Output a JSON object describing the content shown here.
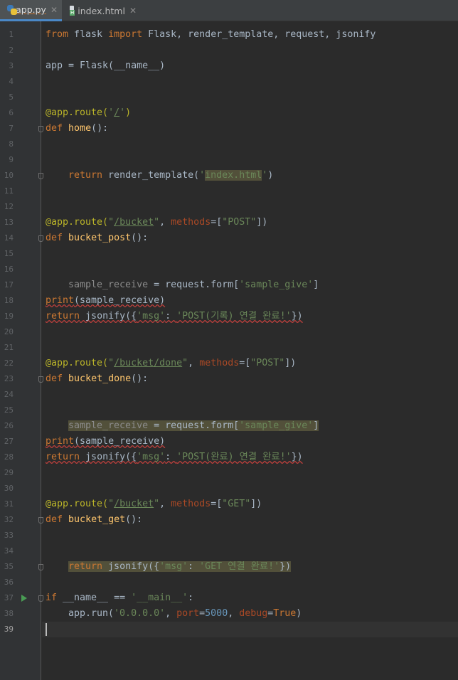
{
  "tabs": [
    {
      "label": "app.py",
      "active": true,
      "icon": "python-file-icon"
    },
    {
      "label": "index.html",
      "active": false,
      "icon": "html-file-icon"
    }
  ],
  "editor": {
    "current_line": 39,
    "run_gutter_line": 37,
    "lines": [
      {
        "n": 1,
        "indent": 0,
        "fold": false,
        "warn": false,
        "hl": false,
        "tokens": [
          [
            "from",
            "kw"
          ],
          [
            " flask ",
            ""
          ],
          [
            "import",
            "kw"
          ],
          [
            " Flask, render_template, request, jsonify",
            ""
          ]
        ]
      },
      {
        "n": 2,
        "indent": 0,
        "fold": false,
        "warn": false,
        "hl": false,
        "tokens": []
      },
      {
        "n": 3,
        "indent": 0,
        "fold": false,
        "warn": false,
        "hl": false,
        "tokens": [
          [
            "app = Flask(__name__)",
            ""
          ]
        ]
      },
      {
        "n": 4,
        "indent": 0,
        "fold": false,
        "warn": false,
        "hl": false,
        "tokens": []
      },
      {
        "n": 5,
        "indent": 0,
        "fold": false,
        "warn": false,
        "hl": false,
        "tokens": []
      },
      {
        "n": 6,
        "indent": 0,
        "fold": false,
        "warn": false,
        "hl": false,
        "tokens": [
          [
            "@app.route(",
            "dec"
          ],
          [
            "'",
            "str"
          ],
          [
            "/",
            "str ul"
          ],
          [
            "'",
            "str"
          ],
          [
            ")",
            "dec"
          ]
        ]
      },
      {
        "n": 7,
        "indent": 0,
        "fold": true,
        "warn": false,
        "hl": false,
        "tokens": [
          [
            "def",
            "kw"
          ],
          [
            " ",
            ""
          ],
          [
            "home",
            "fn"
          ],
          [
            "():",
            ""
          ]
        ]
      },
      {
        "n": 8,
        "indent": 0,
        "fold": false,
        "warn": false,
        "hl": false,
        "tokens": []
      },
      {
        "n": 9,
        "indent": 0,
        "fold": false,
        "warn": false,
        "hl": false,
        "tokens": []
      },
      {
        "n": 10,
        "indent": 1,
        "fold": true,
        "warn": false,
        "hl": false,
        "tokens": [
          [
            "return",
            "kw"
          ],
          [
            " render_template(",
            ""
          ],
          [
            "'",
            "str"
          ],
          [
            "index.html",
            "str hl"
          ],
          [
            "'",
            "str"
          ],
          [
            ")",
            ""
          ]
        ]
      },
      {
        "n": 11,
        "indent": 0,
        "fold": false,
        "warn": false,
        "hl": false,
        "tokens": []
      },
      {
        "n": 12,
        "indent": 0,
        "fold": false,
        "warn": false,
        "hl": false,
        "tokens": []
      },
      {
        "n": 13,
        "indent": 0,
        "fold": false,
        "warn": false,
        "hl": false,
        "tokens": [
          [
            "@app.route(",
            "dec"
          ],
          [
            "\"",
            "str"
          ],
          [
            "/bucket",
            "str ul"
          ],
          [
            "\"",
            "str"
          ],
          [
            ", ",
            ""
          ],
          [
            "methods",
            "prm"
          ],
          [
            "=[",
            ""
          ],
          [
            "\"POST\"",
            "str"
          ],
          [
            "])",
            ""
          ]
        ]
      },
      {
        "n": 14,
        "indent": 0,
        "fold": true,
        "warn": false,
        "hl": false,
        "tokens": [
          [
            "def",
            "kw"
          ],
          [
            " ",
            ""
          ],
          [
            "bucket_post",
            "fn"
          ],
          [
            "():",
            ""
          ]
        ]
      },
      {
        "n": 15,
        "indent": 0,
        "fold": false,
        "warn": false,
        "hl": false,
        "tokens": []
      },
      {
        "n": 16,
        "indent": 0,
        "fold": false,
        "warn": false,
        "hl": false,
        "tokens": []
      },
      {
        "n": 17,
        "indent": 1,
        "fold": false,
        "warn": false,
        "hl": false,
        "tokens": [
          [
            "sample_receive",
            "gray"
          ],
          [
            " = request.form[",
            ""
          ],
          [
            "'sample_give'",
            "str"
          ],
          [
            "]",
            ""
          ]
        ]
      },
      {
        "n": 18,
        "indent": 0,
        "fold": false,
        "warn": true,
        "hl": false,
        "tokens": [
          [
            "print",
            "kw"
          ],
          [
            "(sample_receive)",
            ""
          ]
        ]
      },
      {
        "n": 19,
        "indent": 0,
        "fold": false,
        "warn": true,
        "hl": false,
        "tokens": [
          [
            "return",
            "kw"
          ],
          [
            " jsonify({",
            ""
          ],
          [
            "'msg'",
            "str"
          ],
          [
            ": ",
            ""
          ],
          [
            "'POST(기록) 연결 완료!'",
            "str"
          ],
          [
            "})",
            ""
          ]
        ]
      },
      {
        "n": 20,
        "indent": 0,
        "fold": false,
        "warn": false,
        "hl": false,
        "tokens": []
      },
      {
        "n": 21,
        "indent": 0,
        "fold": false,
        "warn": false,
        "hl": false,
        "tokens": []
      },
      {
        "n": 22,
        "indent": 0,
        "fold": false,
        "warn": false,
        "hl": false,
        "tokens": [
          [
            "@app.route(",
            "dec"
          ],
          [
            "\"",
            "str"
          ],
          [
            "/bucket/done",
            "str ul"
          ],
          [
            "\"",
            "str"
          ],
          [
            ", ",
            ""
          ],
          [
            "methods",
            "prm"
          ],
          [
            "=[",
            ""
          ],
          [
            "\"POST\"",
            "str"
          ],
          [
            "])",
            ""
          ]
        ]
      },
      {
        "n": 23,
        "indent": 0,
        "fold": true,
        "warn": false,
        "hl": false,
        "tokens": [
          [
            "def",
            "kw"
          ],
          [
            " ",
            ""
          ],
          [
            "bucket_done",
            "fn"
          ],
          [
            "():",
            ""
          ]
        ]
      },
      {
        "n": 24,
        "indent": 0,
        "fold": false,
        "warn": false,
        "hl": false,
        "tokens": []
      },
      {
        "n": 25,
        "indent": 0,
        "fold": false,
        "warn": false,
        "hl": false,
        "tokens": []
      },
      {
        "n": 26,
        "indent": 1,
        "fold": false,
        "warn": false,
        "hl": true,
        "tokens": [
          [
            "sample_receive",
            "gray"
          ],
          [
            " = request.form[",
            ""
          ],
          [
            "'sample_give'",
            "str"
          ],
          [
            "]",
            ""
          ]
        ]
      },
      {
        "n": 27,
        "indent": 0,
        "fold": false,
        "warn": true,
        "hl": false,
        "tokens": [
          [
            "print",
            "kw"
          ],
          [
            "(sample_receive)",
            ""
          ]
        ]
      },
      {
        "n": 28,
        "indent": 0,
        "fold": false,
        "warn": true,
        "hl": false,
        "tokens": [
          [
            "return",
            "kw"
          ],
          [
            " jsonify({",
            ""
          ],
          [
            "'msg'",
            "str"
          ],
          [
            ": ",
            ""
          ],
          [
            "'POST(완료) 연결 완료!'",
            "str"
          ],
          [
            "})",
            ""
          ]
        ]
      },
      {
        "n": 29,
        "indent": 0,
        "fold": false,
        "warn": false,
        "hl": false,
        "tokens": []
      },
      {
        "n": 30,
        "indent": 0,
        "fold": false,
        "warn": false,
        "hl": false,
        "tokens": []
      },
      {
        "n": 31,
        "indent": 0,
        "fold": false,
        "warn": false,
        "hl": false,
        "tokens": [
          [
            "@app.route(",
            "dec"
          ],
          [
            "\"",
            "str"
          ],
          [
            "/bucket",
            "str ul"
          ],
          [
            "\"",
            "str"
          ],
          [
            ", ",
            ""
          ],
          [
            "methods",
            "prm"
          ],
          [
            "=[",
            ""
          ],
          [
            "\"GET\"",
            "str"
          ],
          [
            "])",
            ""
          ]
        ]
      },
      {
        "n": 32,
        "indent": 0,
        "fold": true,
        "warn": false,
        "hl": false,
        "tokens": [
          [
            "def",
            "kw"
          ],
          [
            " ",
            ""
          ],
          [
            "bucket_get",
            "fn"
          ],
          [
            "():",
            ""
          ]
        ]
      },
      {
        "n": 33,
        "indent": 0,
        "fold": false,
        "warn": false,
        "hl": false,
        "tokens": []
      },
      {
        "n": 34,
        "indent": 0,
        "fold": false,
        "warn": false,
        "hl": false,
        "tokens": []
      },
      {
        "n": 35,
        "indent": 1,
        "fold": true,
        "warn": false,
        "hl": true,
        "tokens": [
          [
            "return",
            "kw"
          ],
          [
            " jsonify({",
            ""
          ],
          [
            "'msg'",
            "str"
          ],
          [
            ": ",
            ""
          ],
          [
            "'GET 연결 완료!'",
            "str"
          ],
          [
            "})",
            ""
          ]
        ]
      },
      {
        "n": 36,
        "indent": 0,
        "fold": false,
        "warn": false,
        "hl": false,
        "tokens": []
      },
      {
        "n": 37,
        "indent": 0,
        "fold": true,
        "warn": false,
        "hl": false,
        "tokens": [
          [
            "if",
            "kw"
          ],
          [
            " __name__ == ",
            ""
          ],
          [
            "'__main__'",
            "str"
          ],
          [
            ":",
            ""
          ]
        ]
      },
      {
        "n": 38,
        "indent": 1,
        "fold": false,
        "warn": false,
        "hl": false,
        "tokens": [
          [
            "app.run(",
            ""
          ],
          [
            "'0.0.0.0'",
            "str"
          ],
          [
            ", ",
            ""
          ],
          [
            "port",
            "prm"
          ],
          [
            "=",
            ""
          ],
          [
            "5000",
            "num"
          ],
          [
            ", ",
            ""
          ],
          [
            "debug",
            "prm"
          ],
          [
            "=",
            ""
          ],
          [
            "True",
            "kw"
          ],
          [
            ")",
            ""
          ]
        ]
      },
      {
        "n": 39,
        "indent": 0,
        "fold": false,
        "warn": false,
        "hl": false,
        "tokens": []
      }
    ]
  }
}
